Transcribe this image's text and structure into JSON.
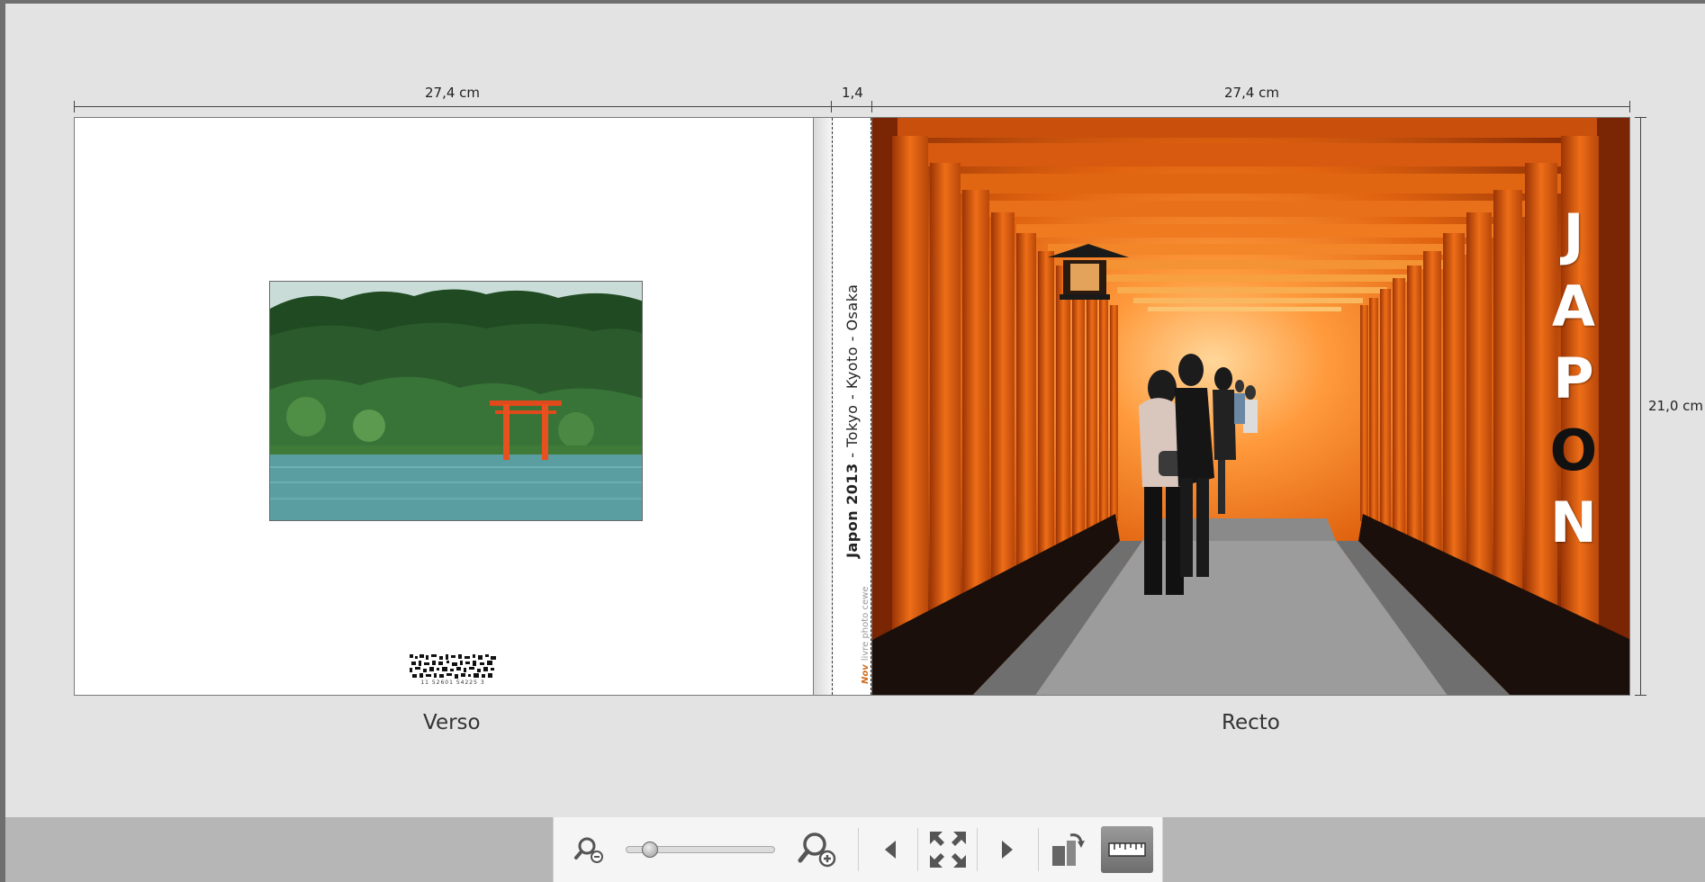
{
  "dimensions": {
    "verso_width": "27,4 cm",
    "spine_width": "1,4",
    "recto_width": "27,4 cm",
    "height": "21,0 cm"
  },
  "verso": {
    "label": "Verso",
    "barcode_number": "11  52601  54225  3"
  },
  "spine": {
    "title": "Japon 2013",
    "subtitle": " - Tokyo - Kyoto - Osaka",
    "brand_logo": "Nov",
    "brand_text": "livre photo cewe"
  },
  "recto": {
    "label": "Recto",
    "title_letters": [
      "J",
      "A",
      "P",
      "O",
      "N"
    ]
  },
  "toolbar": {
    "zoom_level": 0.12,
    "icons": [
      "zoom-out-icon",
      "zoom-in-icon",
      "previous-arrow-icon",
      "fit-to-screen-icon",
      "next-arrow-icon",
      "rotate-view-icon",
      "ruler-icon"
    ]
  }
}
